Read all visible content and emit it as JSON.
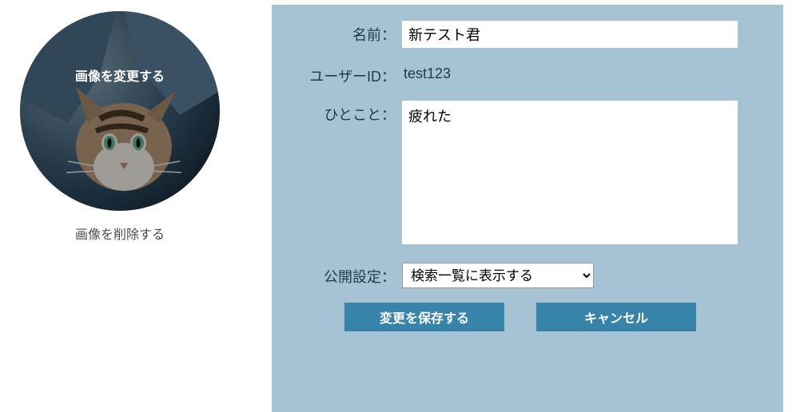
{
  "avatar": {
    "change_label": "画像を変更する",
    "delete_label": "画像を削除する"
  },
  "form": {
    "name_label": "名前：",
    "name_value": "新テスト君",
    "user_id_label": "ユーザーID：",
    "user_id_value": "test123",
    "bio_label": "ひとこと：",
    "bio_value": "疲れた",
    "privacy_label": "公開設定：",
    "privacy_selected": "検索一覧に表示する"
  },
  "buttons": {
    "save": "変更を保存する",
    "cancel": "キャンセル"
  }
}
